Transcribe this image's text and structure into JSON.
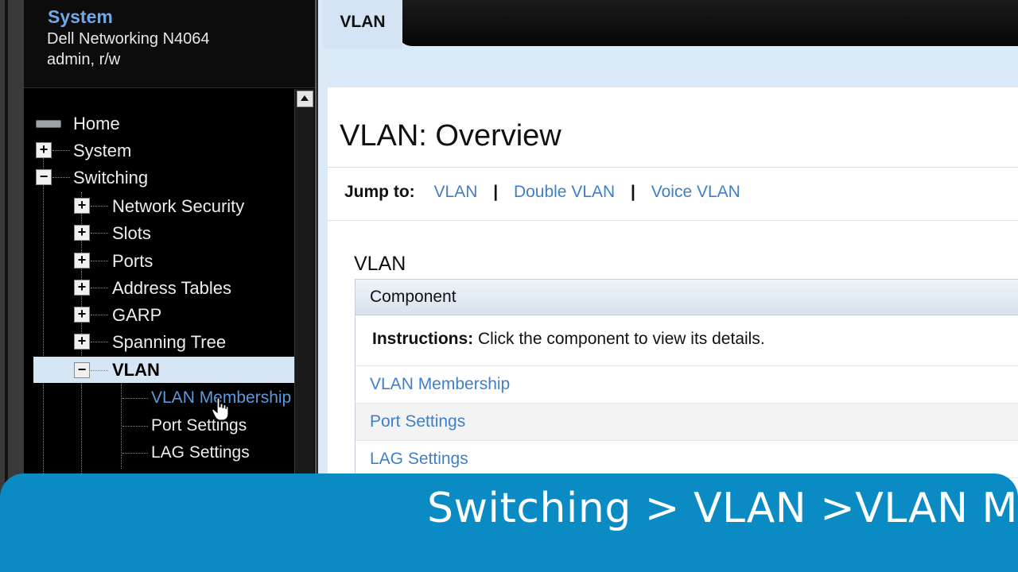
{
  "system": {
    "title": "System",
    "model": "Dell Networking N4064",
    "user": "admin, r/w"
  },
  "nav": {
    "home": "Home",
    "system": "System",
    "switching": "Switching",
    "children": [
      "Network Security",
      "Slots",
      "Ports",
      "Address Tables",
      "GARP",
      "Spanning Tree"
    ],
    "vlan": "VLAN",
    "vlan_children": [
      "VLAN Membership",
      "Port Settings",
      "LAG Settings"
    ]
  },
  "tab": {
    "active": "VLAN"
  },
  "page": {
    "title": "VLAN: Overview",
    "jump_label": "Jump to:",
    "jump_links": [
      "VLAN",
      "Double VLAN",
      "Voice VLAN"
    ],
    "separator": "|",
    "section": "VLAN",
    "table_header": "Component",
    "instructions_label": "Instructions:",
    "instructions_text": " Click the component to view its details.",
    "components": [
      "VLAN Membership",
      "Port Settings",
      "LAG Settings"
    ]
  },
  "banner": {
    "text": "Switching > VLAN >VLAN Membership"
  },
  "icons": {
    "expand": "plus-box-icon",
    "collapse": "minus-box-icon",
    "home": "home-device-icon",
    "cursor": "hand-pointer-icon"
  },
  "colors": {
    "link": "#3f7fc9",
    "sidebar_title": "#6fa9e8",
    "banner": "#0a8bc4",
    "selected_row": "#d7e6f5"
  }
}
